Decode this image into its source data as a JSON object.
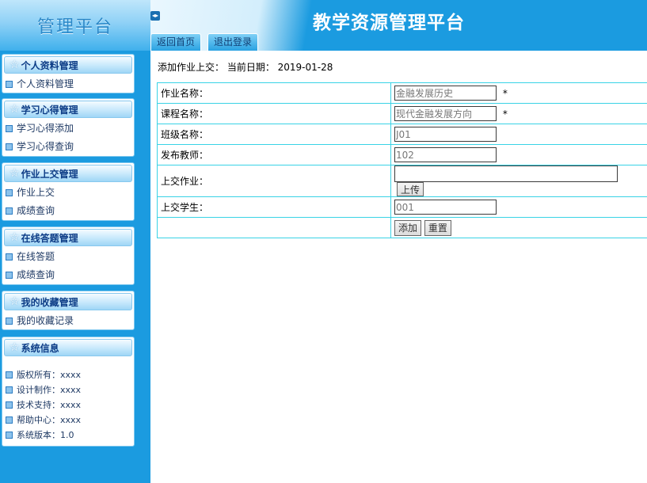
{
  "brand": {
    "title": "管理平台"
  },
  "header": {
    "collapse_icon": "◂▸",
    "title": "教学资源管理平台",
    "tabs": {
      "home": "返回首页",
      "logout": "退出登录"
    }
  },
  "sidebar": {
    "panels": [
      {
        "title": "个人资料管理",
        "items": [
          "个人资料管理"
        ]
      },
      {
        "title": "学习心得管理",
        "items": [
          "学习心得添加",
          "学习心得查询"
        ]
      },
      {
        "title": "作业上交管理",
        "items": [
          "作业上交",
          "成绩查询"
        ]
      },
      {
        "title": "在线答题管理",
        "items": [
          "在线答题",
          "成绩查询"
        ]
      },
      {
        "title": "我的收藏管理",
        "items": [
          "我的收藏记录"
        ]
      },
      {
        "title": "系统信息",
        "items": [
          "版权所有：xxxx",
          "设计制作：xxxx",
          "技术支持：xxxx",
          "帮助中心：xxxx",
          "系统版本：1.0"
        ]
      }
    ]
  },
  "main": {
    "breadcrumb": "添加作业上交： 当前日期： 2019-01-28",
    "form": {
      "homework_name": {
        "label": "作业名称：",
        "value": "金融发展历史",
        "required": "*"
      },
      "course_name": {
        "label": "课程名称：",
        "value": "现代金融发展方向",
        "required": "*"
      },
      "class_name": {
        "label": "班级名称：",
        "value": "J01"
      },
      "teacher": {
        "label": "发布教师：",
        "value": "102"
      },
      "upload": {
        "label": "上交作业：",
        "value": "",
        "button": "上传"
      },
      "student": {
        "label": "上交学生：",
        "value": "001"
      },
      "buttons": {
        "add": "添加",
        "reset": "重置"
      }
    }
  }
}
